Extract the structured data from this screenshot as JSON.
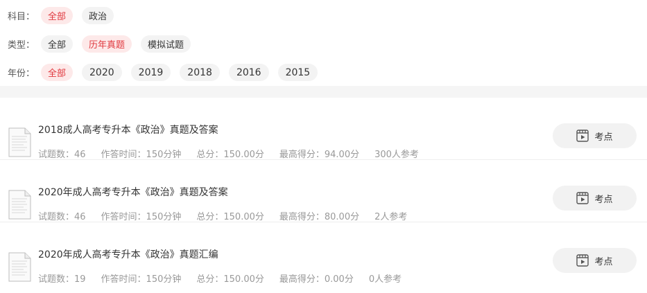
{
  "filters": {
    "subject": {
      "label": "科目：",
      "options": [
        "全部",
        "政治"
      ],
      "active": 0
    },
    "type": {
      "label": "类型：",
      "options": [
        "全部",
        "历年真题",
        "模拟试题"
      ],
      "active": 1
    },
    "year": {
      "label": "年份：",
      "options": [
        "全部",
        "2020",
        "2019",
        "2018",
        "2016",
        "2015"
      ],
      "active": 0
    }
  },
  "papers": [
    {
      "title": "2018成人高考专升本《政治》真题及答案",
      "count": "试题数：46",
      "time": "作答时间：150分钟",
      "total": "总分：150.00分",
      "best": "最高得分：94.00分",
      "takers": "300人参考",
      "button": "考点"
    },
    {
      "title": "2020年成人高考专升本《政治》真题及答案",
      "count": "试题数：46",
      "time": "作答时间：150分钟",
      "total": "总分：150.00分",
      "best": "最高得分：80.00分",
      "takers": "2人参考",
      "button": "考点"
    },
    {
      "title": "2020年成人高考专升本《政治》真题汇编",
      "count": "试题数：19",
      "time": "作答时间：150分钟",
      "total": "总分：150.00分",
      "best": "最高得分：0.00分",
      "takers": "0人参考",
      "button": "考点"
    }
  ],
  "colors": {
    "accent": "#e0383e",
    "chip_active_bg": "#fde9e9",
    "chip_bg": "#f3f3f3"
  },
  "icons": {
    "document": "document-icon",
    "video": "play-icon"
  }
}
